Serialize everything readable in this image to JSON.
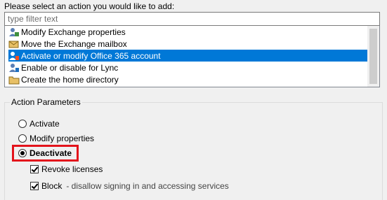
{
  "prompt": "Please select an action you would like to add:",
  "filter": {
    "placeholder": "type filter text",
    "value": ""
  },
  "actions": [
    {
      "label": "Modify Exchange properties",
      "icon": "exchange-user-icon",
      "selected": false
    },
    {
      "label": "Move the Exchange mailbox",
      "icon": "mailbox-icon",
      "selected": false
    },
    {
      "label": "Activate or modify Office 365 account",
      "icon": "office365-user-icon",
      "selected": true
    },
    {
      "label": "Enable or disable for Lync",
      "icon": "lync-user-icon",
      "selected": false
    },
    {
      "label": "Create the home directory",
      "icon": "home-folder-icon",
      "selected": false
    }
  ],
  "group": {
    "title": "Action Parameters",
    "options": [
      {
        "label": "Activate",
        "selected": false
      },
      {
        "label": "Modify properties",
        "selected": false
      },
      {
        "label": "Deactivate",
        "selected": true
      }
    ],
    "checkboxes": [
      {
        "label": "Revoke licenses",
        "checked": true,
        "description": ""
      },
      {
        "label": "Block",
        "checked": true,
        "description": "- disallow signing in and accessing services"
      }
    ]
  },
  "colors": {
    "selection": "#0078d7",
    "highlight": "#e3131b"
  }
}
